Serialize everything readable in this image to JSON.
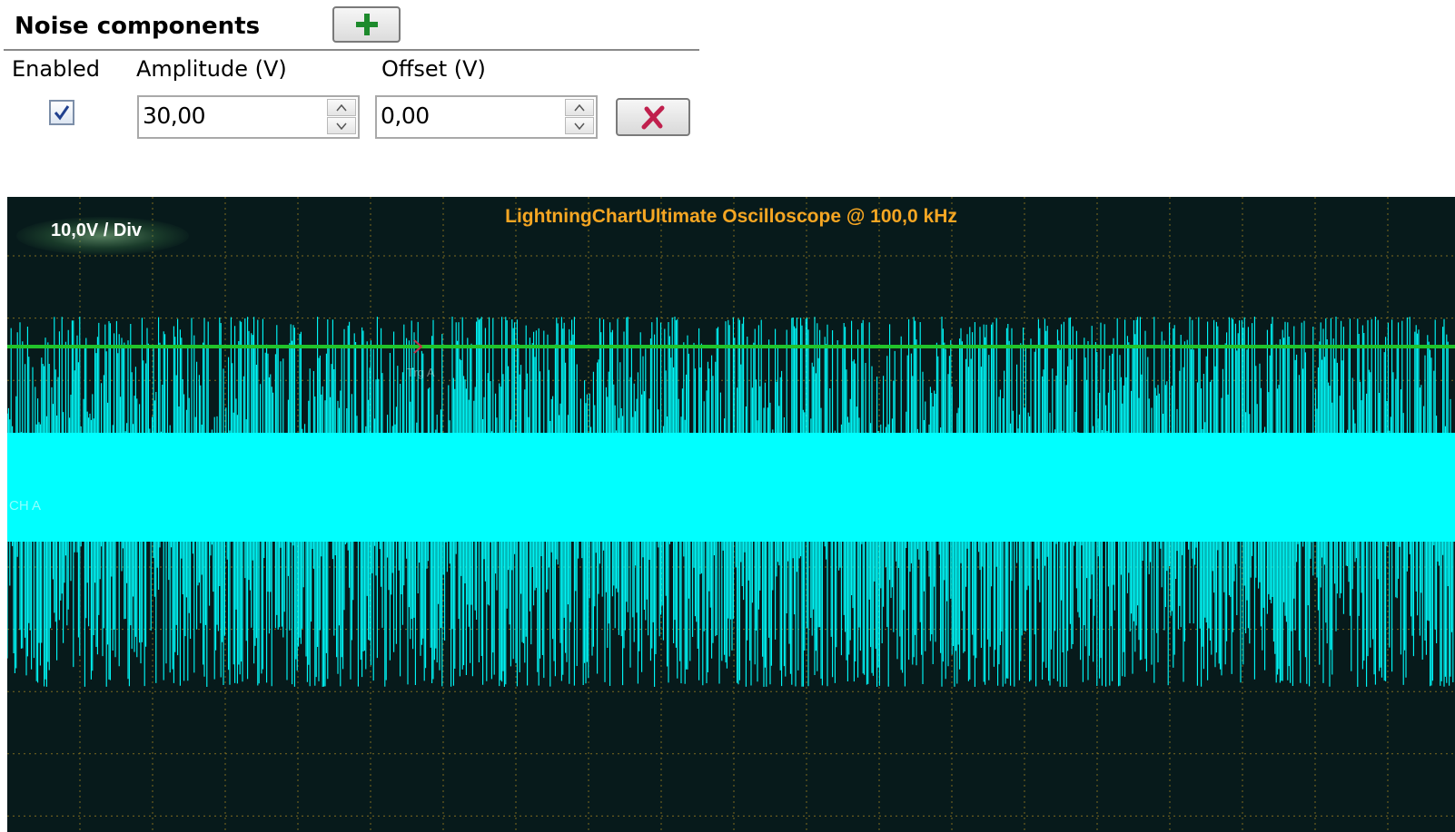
{
  "noise_panel": {
    "title": "Noise components",
    "add_button_icon": "plus-icon",
    "columns": {
      "enabled": "Enabled",
      "amplitude": "Amplitude (V)",
      "offset": "Offset (V)"
    },
    "row": {
      "enabled": true,
      "amplitude": "30,00",
      "offset": "0,00",
      "delete_button_icon": "x-icon"
    }
  },
  "chart_data": {
    "type": "line",
    "title": "LightningChartUltimate Oscilloscope @ 100,0 kHz",
    "scale_label": "10,0V / Div",
    "series": [
      {
        "name": "CH A"
      }
    ],
    "trigger_label": "Trg A",
    "grid": true,
    "colors": {
      "background": "#071a1b",
      "trace": "#00ffff",
      "trigger_line": "#22c32a",
      "title": "#f5a623",
      "grid": "#9a7d20"
    }
  }
}
